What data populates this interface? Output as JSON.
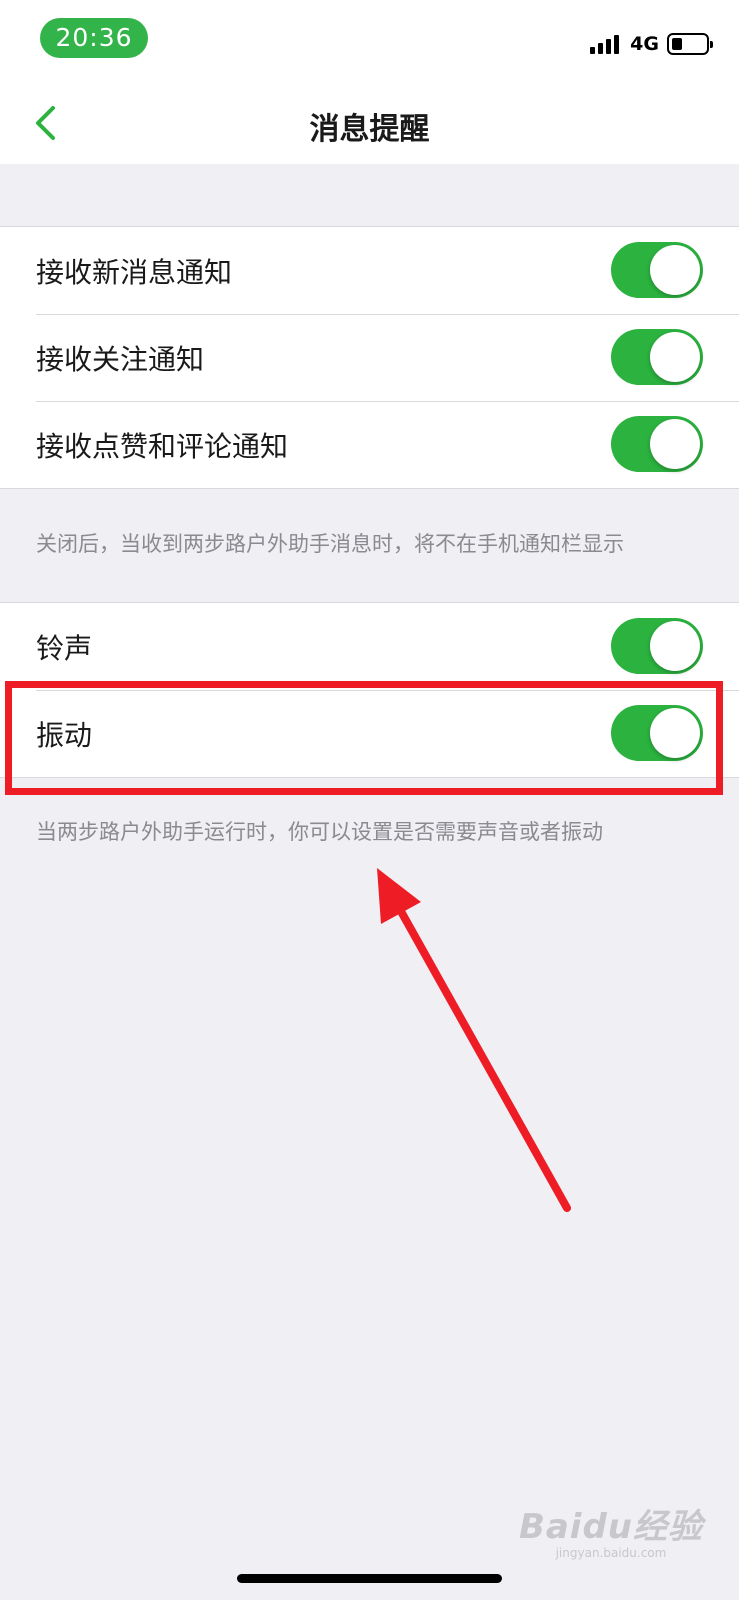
{
  "status_bar": {
    "time": "20:36",
    "network": "4G",
    "icons": [
      "signal-icon",
      "battery-icon"
    ]
  },
  "nav": {
    "title": "消息提醒",
    "back_icon": "chevron-left-icon"
  },
  "notification_settings": {
    "items": [
      {
        "label": "接收新消息通知",
        "enabled": true
      },
      {
        "label": "接收关注通知",
        "enabled": true
      },
      {
        "label": "接收点赞和评论通知",
        "enabled": true
      }
    ],
    "footnote": "关闭后，当收到两步路户外助手消息时，将不在手机通知栏显示"
  },
  "alert_settings": {
    "items": [
      {
        "label": "铃声",
        "enabled": true
      },
      {
        "label": "振动",
        "enabled": true
      }
    ],
    "footnote": "当两步路户外助手运行时，你可以设置是否需要声音或者振动"
  },
  "watermark": {
    "logo": "Baidu经验",
    "sub": "jingyan.baidu.com"
  },
  "colors": {
    "accent_green": "#2bb23f",
    "time_pill": "#32b44a",
    "annotation_red": "#ee1c25",
    "background": "#efeff4"
  }
}
